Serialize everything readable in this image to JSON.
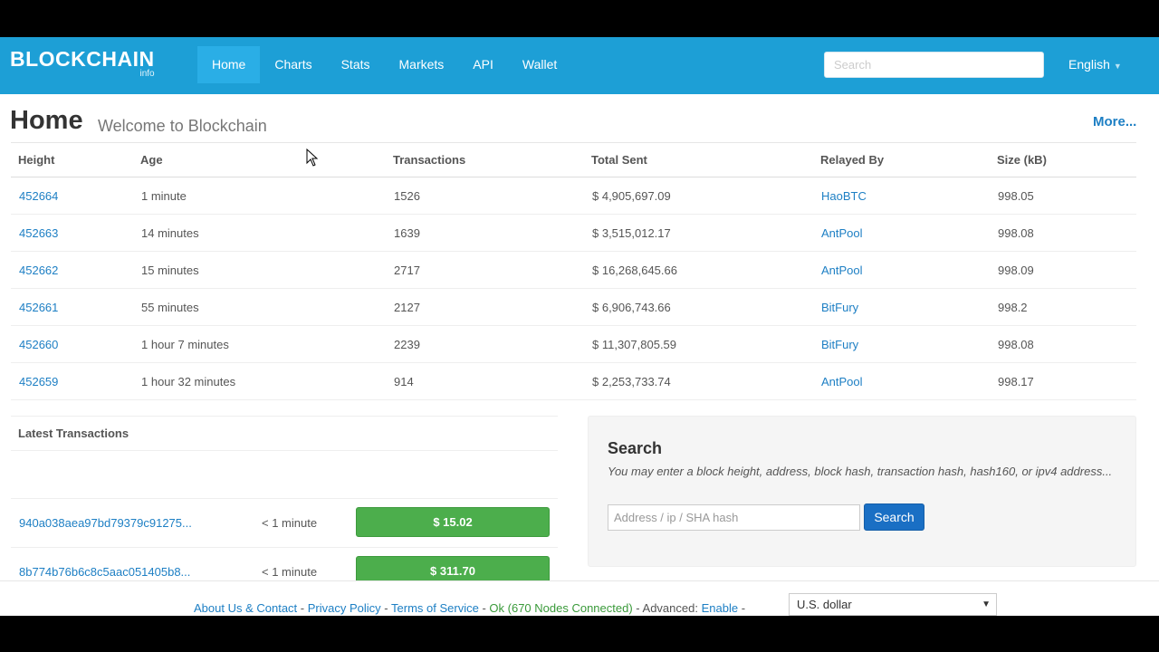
{
  "brand": {
    "name": "BLOCKCHAIN",
    "sub": "info"
  },
  "nav": {
    "items": [
      {
        "label": "Home"
      },
      {
        "label": "Charts"
      },
      {
        "label": "Stats"
      },
      {
        "label": "Markets"
      },
      {
        "label": "API"
      },
      {
        "label": "Wallet"
      }
    ],
    "active_item": "Home",
    "search_placeholder": "Search",
    "language": "English"
  },
  "header": {
    "title": "Home",
    "subtitle": "Welcome to Blockchain",
    "more_label": "More..."
  },
  "blocks": {
    "columns": [
      "Height",
      "Age",
      "Transactions",
      "Total Sent",
      "Relayed By",
      "Size (kB)"
    ],
    "rows": [
      {
        "height": "452664",
        "age": "1 minute",
        "transactions": "1526",
        "total_sent": "$ 4,905,697.09",
        "relayed_by": "HaoBTC",
        "size": "998.05"
      },
      {
        "height": "452663",
        "age": "14 minutes",
        "transactions": "1639",
        "total_sent": "$ 3,515,012.17",
        "relayed_by": "AntPool",
        "size": "998.08"
      },
      {
        "height": "452662",
        "age": "15 minutes",
        "transactions": "2717",
        "total_sent": "$ 16,268,645.66",
        "relayed_by": "AntPool",
        "size": "998.09"
      },
      {
        "height": "452661",
        "age": "55 minutes",
        "transactions": "2127",
        "total_sent": "$ 6,906,743.66",
        "relayed_by": "BitFury",
        "size": "998.2"
      },
      {
        "height": "452660",
        "age": "1 hour 7 minutes",
        "transactions": "2239",
        "total_sent": "$ 11,307,805.59",
        "relayed_by": "BitFury",
        "size": "998.08"
      },
      {
        "height": "452659",
        "age": "1 hour 32 minutes",
        "transactions": "914",
        "total_sent": "$ 2,253,733.74",
        "relayed_by": "AntPool",
        "size": "998.17"
      }
    ]
  },
  "latest": {
    "title": "Latest Transactions",
    "rows": [
      {
        "hash": "940a038aea97bd79379c91275...",
        "age": "< 1 minute",
        "amount": "$ 15.02"
      },
      {
        "hash": "8b774b76b6c8c5aac051405b8...",
        "age": "< 1 minute",
        "amount": "$ 311.70"
      }
    ]
  },
  "search": {
    "title": "Search",
    "help": "You may enter a block height, address, block hash, transaction hash, hash160, or ipv4 address...",
    "placeholder": "Address / ip / SHA hash",
    "button_label": "Search"
  },
  "footer": {
    "about": "About Us & Contact",
    "privacy": "Privacy Policy",
    "terms": "Terms of Service",
    "status": "Ok (670 Nodes Connected)",
    "advanced": "Advanced:",
    "enable": "Enable",
    "currency": "U.S. dollar"
  },
  "colors": {
    "navbar": "#1d9fd6",
    "link": "#1d7fc4",
    "amount_button": "#4cae4c",
    "search_button": "#1a6fc4"
  },
  "icons": [
    "cursor-arrow-icon",
    "caret-down-icon",
    "select-arrow-icon"
  ]
}
